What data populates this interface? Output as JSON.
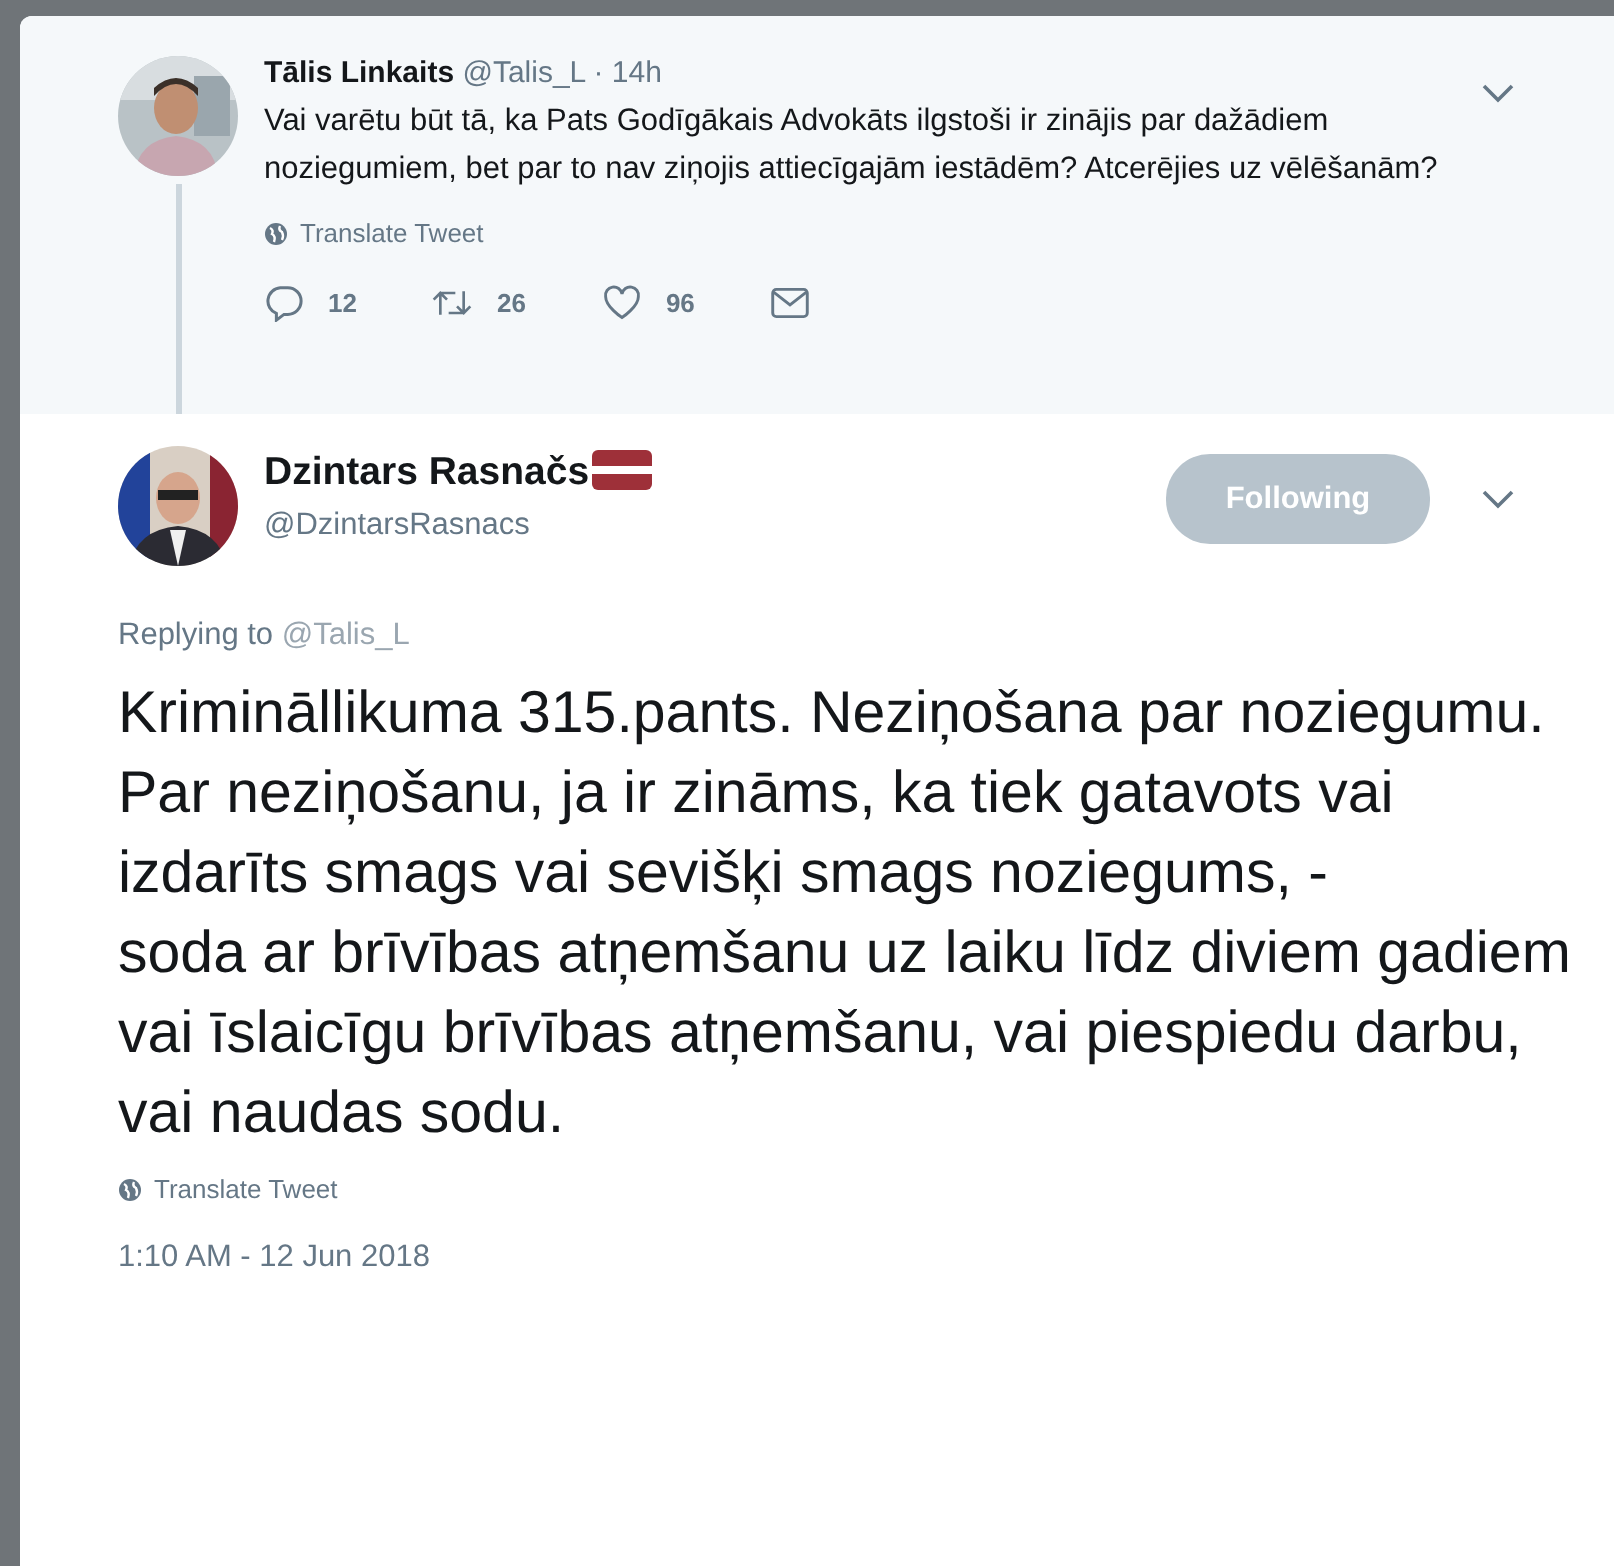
{
  "parent_tweet": {
    "name": "Tālis Linkaits",
    "handle": "@Talis_L",
    "time": "· 14h",
    "text": "Vai varētu būt tā, ka Pats Godīgākais Advokāts ilgstoši ir zinājis par dažādiem noziegumiem, bet par to nav ziņojis attiecīgajām iestādēm? Atcerējies uz vēlēšanām?",
    "translate": "Translate Tweet",
    "actions": [
      {
        "kind": "reply",
        "count": "12"
      },
      {
        "kind": "retweet",
        "count": "26"
      },
      {
        "kind": "like",
        "count": "96"
      },
      {
        "kind": "message"
      }
    ]
  },
  "tweet": {
    "name": "Dzintars Rasnačs",
    "handle": "@DzintarsRasnacs",
    "follow_button": "Following",
    "replying_label": "Replying to",
    "replying_to": "@Talis_L",
    "paragraphs": [
      "Krimināllikuma 315.pants. Neziņošana par noziegumu.",
      "Par neziņošanu, ja ir zināms, ka tiek gatavots vai izdarīts smags vai sevišķi smags noziegums, -",
      "soda ar brīvības atņemšanu uz laiku līdz diviem gadiem vai īslaicīgu brīvības atņemšanu, vai piespiedu darbu, vai naudas sodu."
    ],
    "translate": "Translate Tweet",
    "timestamp": "1:10 AM - 12 Jun 2018"
  }
}
